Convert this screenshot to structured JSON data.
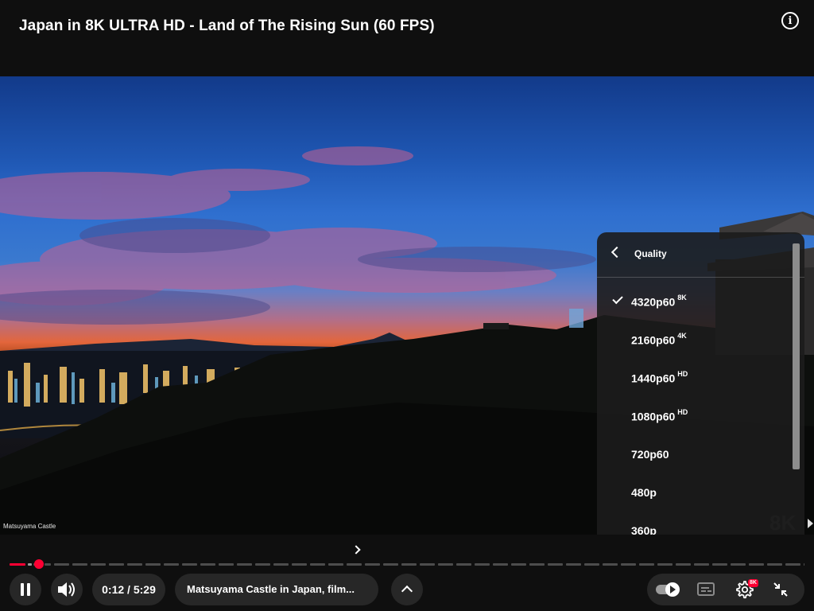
{
  "header": {
    "title": "Japan in 8K ULTRA HD - Land of The Rising Sun (60 FPS)",
    "info_icon": "info-icon",
    "info_glyph": "i"
  },
  "video": {
    "caption": "Matsuyama Castle",
    "watermark": "8K"
  },
  "quality_menu": {
    "title": "Quality",
    "back_icon": "chevron-left-icon",
    "selected_icon": "check-icon",
    "items": [
      {
        "label": "4320p60",
        "badge": "8K",
        "selected": true
      },
      {
        "label": "2160p60",
        "badge": "4K",
        "selected": false
      },
      {
        "label": "1440p60",
        "badge": "HD",
        "selected": false
      },
      {
        "label": "1080p60",
        "badge": "HD",
        "selected": false
      },
      {
        "label": "720p60",
        "badge": "",
        "selected": false
      },
      {
        "label": "480p",
        "badge": "",
        "selected": false
      },
      {
        "label": "360p",
        "badge": "",
        "selected": false
      }
    ]
  },
  "player": {
    "time_display": "0:12 / 5:29",
    "chapter_title": "Matsuyama Castle in Japan, film...",
    "settings_badge": "8K",
    "accent_color": "#ff0033",
    "icons": {
      "pause": "pause-icon",
      "volume": "volume-icon",
      "chapter_next": "chevron-right-icon",
      "expand": "chevron-up-icon",
      "autoplay": "autoplay-toggle-icon",
      "captions": "captions-icon",
      "settings": "gear-icon",
      "exit_fullscreen": "exit-fullscreen-icon"
    }
  }
}
